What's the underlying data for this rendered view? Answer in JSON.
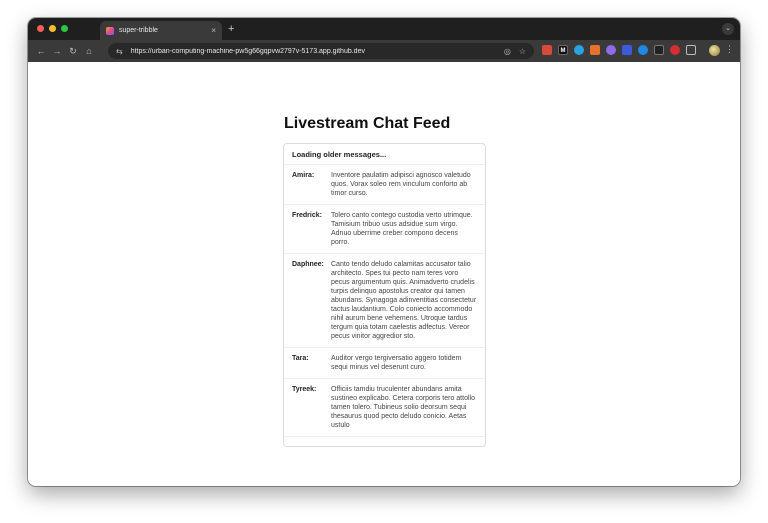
{
  "browser": {
    "tab_title": "super-tribble",
    "tab_close": "×",
    "new_tab": "+",
    "url": "https://urban-computing-machine-pw5g66gqpvw2797v-5173.app.github.dev",
    "colors": {
      "traffic_red": "#ff5f57",
      "traffic_yellow": "#febc2e",
      "traffic_green": "#28c840"
    }
  },
  "page": {
    "title": "Livestream Chat Feed",
    "loading_text": "Loading older messages..."
  },
  "messages": [
    {
      "author": "Amira:",
      "text": "Inventore paulatim adipisci agnosco valetudo quos. Vorax soleo rem vinculum conforto ab timor curso."
    },
    {
      "author": "Fredrick:",
      "text": "Tolero canto contego custodia verto utrimque. Tamisium tribuo usus adsidue sum virgo. Adnuo uberrime creber compono decens porro."
    },
    {
      "author": "Daphnee:",
      "text": "Canto tendo deludo calamitas accusator talio architecto. Spes tui pecto nam teres voro pecus argumentum quis. Animadverto crudelis turpis delinquo apostolus creator qui tamen abundans. Synagoga adinventitias consectetur tactus laudantium. Colo coniecto accommodo nihil aurum bene vehemens. Utroque tardus tergum quia totam caelestis adfectus. Vereor pecus vinitor aggredior sto."
    },
    {
      "author": "Tara:",
      "text": "Auditor vergo tergiversatio aggero totidem sequi minus vel deserunt curo."
    },
    {
      "author": "Tyreek:",
      "text": "Officiis tamdiu truculenter abundans amita sustineo explicabo. Cetera corporis tero attollo tamen tolero. Tubineus solio deorsum sequi thesaurus quod pecto deludo conicio. Aetas ustulo"
    }
  ]
}
